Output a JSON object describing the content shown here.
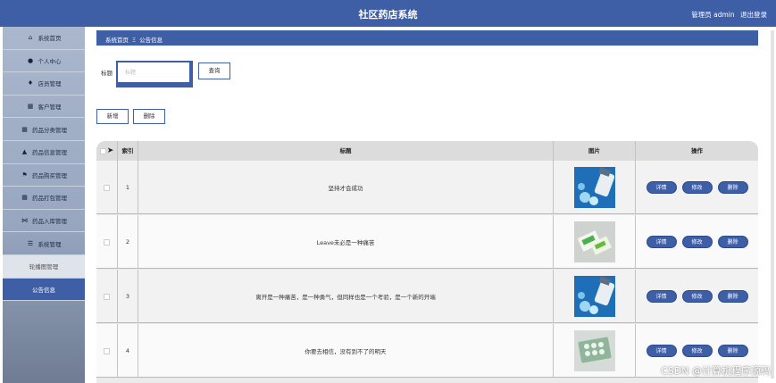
{
  "header": {
    "title": "社区药店系统",
    "user": "管理员 admin",
    "logout": "退出登录"
  },
  "sidebar": {
    "items": [
      {
        "label": "系统首页",
        "icon": "home-icon",
        "glyph": "⌂"
      },
      {
        "label": "个人中心",
        "icon": "user-icon",
        "glyph": "●"
      },
      {
        "label": "店员管理",
        "icon": "location-pin-icon",
        "glyph": "♦"
      },
      {
        "label": "客户管理",
        "icon": "grid-icon",
        "glyph": "▦"
      },
      {
        "label": "药品分类管理",
        "icon": "grid-icon",
        "glyph": "▦"
      },
      {
        "label": "药品信息管理",
        "icon": "thumbs-up-icon",
        "glyph": "▲"
      },
      {
        "label": "药品购买管理",
        "icon": "flag-icon",
        "glyph": "⚑"
      },
      {
        "label": "药品打包管理",
        "icon": "grid-icon",
        "glyph": "▦"
      },
      {
        "label": "药品入库管理",
        "icon": "bowtie-icon",
        "glyph": "⋈"
      },
      {
        "label": "系统管理",
        "icon": "list-icon",
        "glyph": "☰"
      }
    ],
    "subitems": [
      {
        "label": "轮播图管理"
      },
      {
        "label": "公告信息"
      }
    ]
  },
  "breadcrumb": {
    "home": "系统首页",
    "separator": "Ξ",
    "current": "公告信息"
  },
  "search": {
    "label": "标题",
    "placeholder": "标题",
    "query_button": "查询"
  },
  "toolbar": {
    "add_button": "新增",
    "delete_button": "删除"
  },
  "table": {
    "columns": [
      "",
      "索引",
      "标题",
      "图片",
      "操作"
    ],
    "rows": [
      {
        "index": "1",
        "title": "坚持才会成功",
        "image": "medicine-photo-blue-bottle"
      },
      {
        "index": "2",
        "title": "Leave未必是一种痛苦",
        "image": "medicine-photo-green-box"
      },
      {
        "index": "3",
        "title": "离开是一种痛苦，是一种勇气，但同样也是一个考验，是一个新的开端",
        "image": "medicine-photo-blue-bottle"
      },
      {
        "index": "4",
        "title": "你要去相信，没有到不了的明天",
        "image": "medicine-photo-blister-pack"
      }
    ],
    "actions": {
      "detail": "详情",
      "edit": "修改",
      "delete": "删除"
    }
  },
  "watermark": "CSDN @计算机程序源码",
  "colors": {
    "primary": "#3e5ea5"
  }
}
